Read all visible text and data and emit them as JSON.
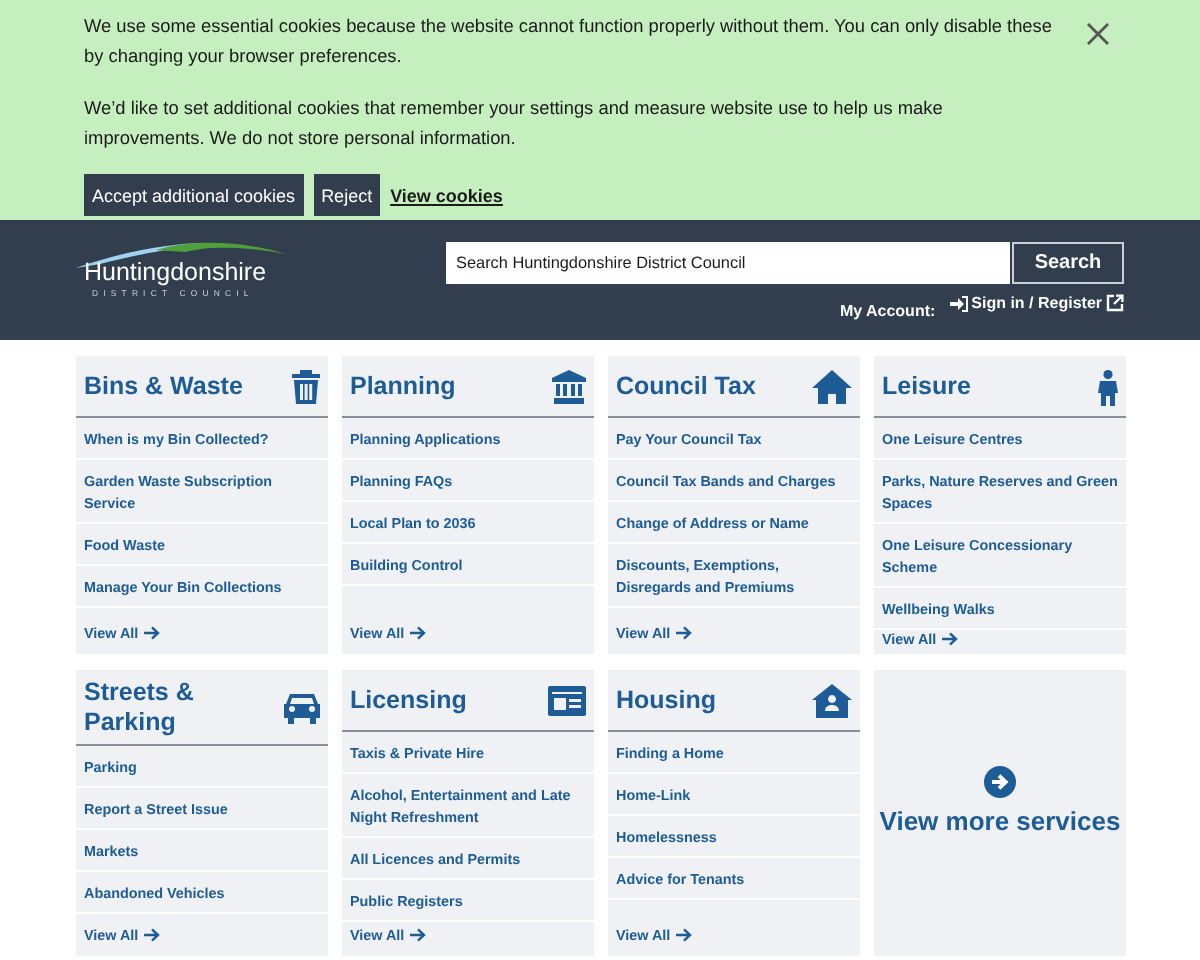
{
  "cookie_banner": {
    "paragraphs": [
      "We use some essential cookies because the website cannot function properly without them. You can only disable these by changing your browser preferences.",
      "We’d like to set additional cookies that remember your settings and measure website use to help us make improvements. We do not store personal information."
    ],
    "buttons": [
      "Accept additional cookies",
      "Reject"
    ],
    "link": "View cookies"
  },
  "header": {
    "logo": {
      "name": "Huntingdonshire",
      "subtitle": "DISTRICT COUNCIL"
    },
    "search": {
      "placeholder": "Search Huntingdonshire District Council",
      "button": "Search"
    },
    "account_label": "My Account:",
    "sign_in": "Sign in / Register"
  },
  "services": [
    {
      "title": "Bins & Waste",
      "links": [
        "When is my Bin Collected?",
        "Garden Waste Subscription Service",
        "Food Waste",
        "Manage Your Bin Collections"
      ],
      "view_all": "View All"
    },
    {
      "title": "Planning",
      "links": [
        "Planning Applications",
        "Planning FAQs",
        "Local Plan to 2036",
        "Building Control"
      ],
      "view_all": "View All"
    },
    {
      "title": "Council Tax",
      "links": [
        "Pay Your Council Tax",
        "Council Tax Bands and Charges",
        "Change of Address or Name",
        "Discounts, Exemptions, Disregards and Premiums"
      ],
      "view_all": "View All"
    },
    {
      "title": "Leisure",
      "links": [
        "One Leisure Centres",
        "Parks, Nature Reserves and Green Spaces",
        "One Leisure Concessionary Scheme",
        "Wellbeing Walks"
      ],
      "view_all": "View All"
    },
    {
      "title": "Streets & Parking",
      "links": [
        "Parking",
        "Report a Street Issue",
        "Markets",
        "Abandoned Vehicles"
      ],
      "view_all": "View All"
    },
    {
      "title": "Licensing",
      "links": [
        "Taxis & Private Hire",
        "Alcohol, Entertainment and Late Night Refreshment",
        "All Licences and Permits",
        "Public Registers"
      ],
      "view_all": "View All"
    },
    {
      "title": "Housing",
      "links": [
        "Finding a Home",
        "Home-Link",
        "Homelessness",
        "Advice for Tenants"
      ],
      "view_all": "View All"
    }
  ],
  "view_more": "View more services"
}
